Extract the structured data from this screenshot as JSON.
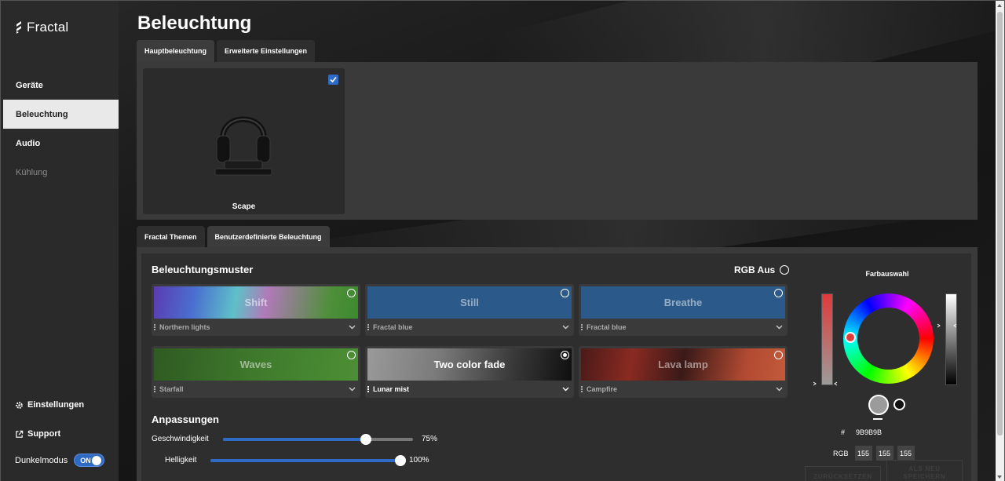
{
  "app": {
    "brand": "Fractal"
  },
  "sidebar": {
    "items": [
      {
        "label": "Geräte",
        "state": "normal"
      },
      {
        "label": "Beleuchtung",
        "state": "active"
      },
      {
        "label": "Audio",
        "state": "normal"
      },
      {
        "label": "Kühlung",
        "state": "disabled"
      }
    ],
    "settings_label": "Einstellungen",
    "support_label": "Support",
    "darkmode_label": "Dunkelmodus",
    "darkmode_state": "ON"
  },
  "page": {
    "title": "Beleuchtung",
    "top_tabs": [
      "Hauptbeleuchtung",
      "Erweiterte Einstellungen"
    ],
    "device": {
      "name": "Scape",
      "checked": true
    },
    "lower_tabs": [
      "Fractal Themen",
      "Benutzerdefinierte Beleuchtung"
    ]
  },
  "patterns": {
    "title": "Beleuchtungsmuster",
    "rgb_off_label": "RGB Aus",
    "cards": [
      {
        "name": "Shift",
        "preset": "Northern lights",
        "selected": false
      },
      {
        "name": "Still",
        "preset": "Fractal blue",
        "selected": false
      },
      {
        "name": "Breathe",
        "preset": "Fractal blue",
        "selected": false
      },
      {
        "name": "Waves",
        "preset": "Starfall",
        "selected": false
      },
      {
        "name": "Two color fade",
        "preset": "Lunar mist",
        "selected": true
      },
      {
        "name": "Lava lamp",
        "preset": "Campfire",
        "selected": false
      }
    ]
  },
  "adjustments": {
    "title": "Anpassungen",
    "speed": {
      "label": "Geschwindigkeit",
      "value": 75,
      "value_label": "75%"
    },
    "brightness": {
      "label": "Helligkeit",
      "value": 100,
      "value_label": "100%"
    }
  },
  "color_picker": {
    "title": "Farbauswahl",
    "hex_prefix": "#",
    "hex": "9B9B9B",
    "rgb_label": "RGB",
    "rgb": [
      "155",
      "155",
      "155"
    ],
    "reset_label": "ZURÜCKSETZEN",
    "save_label": "ALS NEU SPEICHERN"
  },
  "colors": {
    "accent": "#2f6bc4",
    "swatch": "#9b9b9b"
  }
}
